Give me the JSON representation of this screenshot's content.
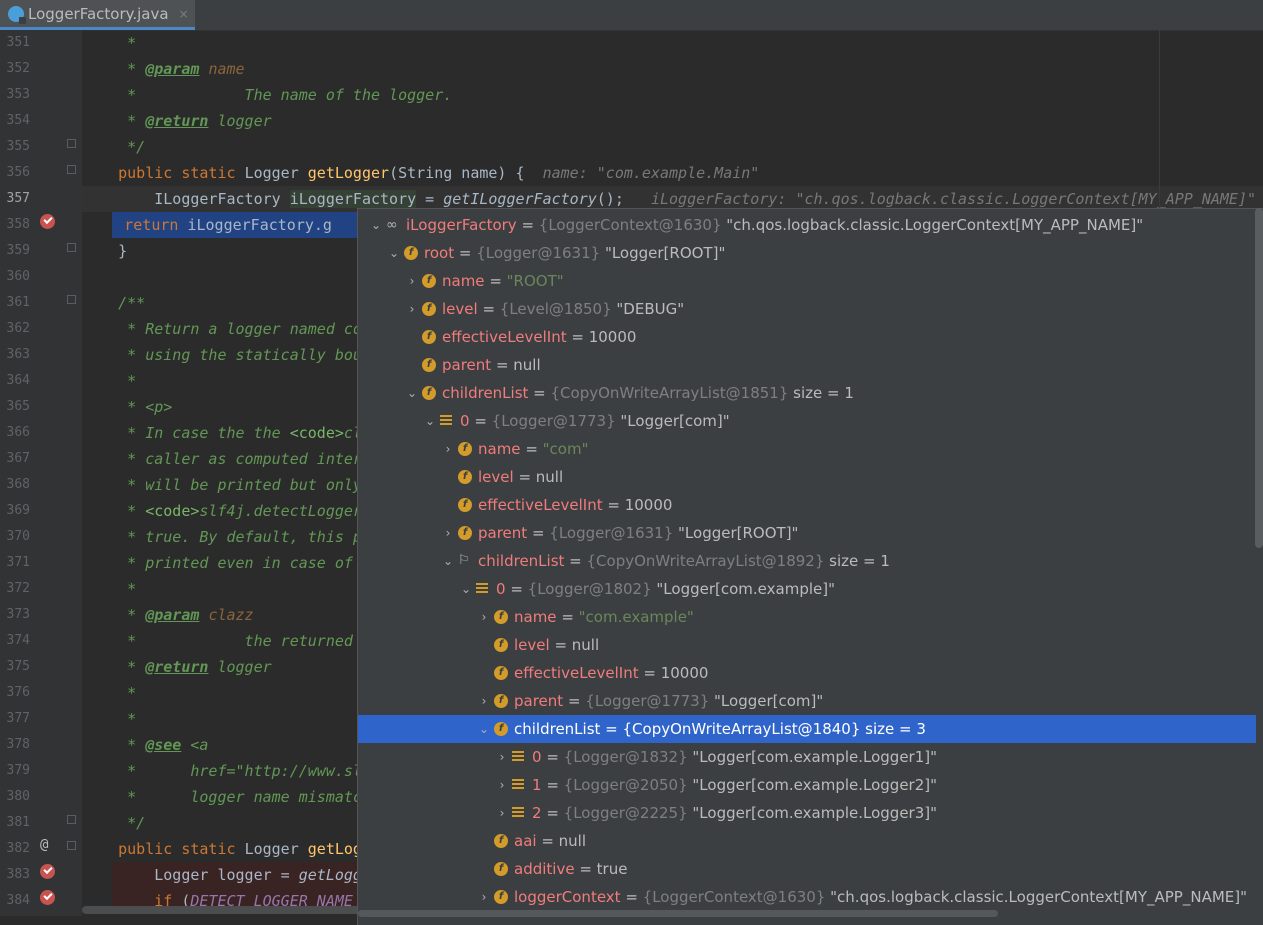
{
  "tab": {
    "title": "LoggerFactory.java",
    "close": "×"
  },
  "gutter": {
    "lines": [
      "351",
      "352",
      "353",
      "354",
      "355",
      "356",
      "357",
      "358",
      "359",
      "360",
      "361",
      "362",
      "363",
      "364",
      "365",
      "366",
      "367",
      "368",
      "369",
      "370",
      "371",
      "372",
      "373",
      "374",
      "375",
      "376",
      "377",
      "378",
      "379",
      "380",
      "381",
      "382",
      "383",
      "384"
    ]
  },
  "code": {
    "l351": "     *",
    "l352_a": "     * ",
    "l352_tag": "@param",
    "l352_b": " ",
    "l352_v": "name",
    "l353": "     *            The name of the logger.",
    "l354_a": "     * ",
    "l354_tag": "@return",
    "l354_b": " logger",
    "l355": "     */",
    "l356_kw": "    public static ",
    "l356_t": "Logger ",
    "l356_fn": "getLogger",
    "l356_r": "(String name) {  ",
    "l356_inl": "name: \"com.example.Main\"",
    "l357_a": "        ILoggerFactory ",
    "l357_v": "iLoggerFactory",
    "l357_b": " = ",
    "l357_c": "getILoggerFactory",
    "l357_d": "();",
    "l357_inl": "   iLoggerFactory: \"ch.qos.logback.classic.LoggerContext[MY_APP_NAME]\"",
    "l358_kw": "        return ",
    "l358_r": "iLoggerFactory.g",
    "l359": "    }",
    "l361": "    /**",
    "l362": "     * Return a logger named co",
    "l363": "     * using the statically bou",
    "l364": "     *",
    "l365": "     * <p>",
    "l366_a": "     * In case the the ",
    "l366_b": "<code>",
    "l366_c": "cl",
    "l367": "     * caller as computed inter",
    "l368": "     * will be printed but only",
    "l369_a": "     * ",
    "l369_b": "<code>",
    "l369_c": "slf4j.detectLogger",
    "l370": "     * true. By default, this p",
    "l371": "     * printed even in case of ",
    "l372": "     *",
    "l373_a": "     * ",
    "l373_tag": "@param",
    "l373_b": " ",
    "l373_v": "clazz",
    "l374": "     *            the returned ",
    "l375_a": "     * ",
    "l375_tag": "@return",
    "l375_b": " logger",
    "l376": "     *",
    "l377": "     *",
    "l378_a": "     * ",
    "l378_tag": "@see",
    "l378_b": " <a",
    "l379": "     *      href=\"http://www.sl",
    "l380": "     *      logger name mismatc",
    "l381": "     */",
    "l382_kw": "    public static ",
    "l382_t": "Logger ",
    "l382_fn": "getLogg",
    "l383_a": "        Logger logger = ",
    "l383_b": "getLogg",
    "l384_kw": "        if ",
    "l384_a": "(",
    "l384_st": "DETECT_LOGGER_NAME_"
  },
  "debugger": {
    "rows": [
      {
        "arrow": "⌄",
        "icon": "oo",
        "name": "iLoggerFactory",
        "eq": " = ",
        "ref": "{LoggerContext@1630}",
        "val": " \"ch.qos.logback.classic.LoggerContext[MY_APP_NAME]\""
      },
      {
        "arrow": "⌄",
        "icon": "f",
        "name": "root",
        "eq": " = ",
        "ref": "{Logger@1631}",
        "val": " \"Logger[ROOT]\""
      },
      {
        "arrow": "›",
        "icon": "f",
        "name": "name",
        "eq": " = ",
        "sval": "\"ROOT\""
      },
      {
        "arrow": "›",
        "icon": "f",
        "name": "level",
        "eq": " = ",
        "ref": "{Level@1850}",
        "val": " \"DEBUG\""
      },
      {
        "arrow": "",
        "icon": "f",
        "name": "effectiveLevelInt",
        "eq": " = ",
        "val": "10000"
      },
      {
        "arrow": "",
        "icon": "f",
        "name": "parent",
        "eq": " = ",
        "val": "null"
      },
      {
        "arrow": "⌄",
        "icon": "f",
        "name": "childrenList",
        "eq": " = ",
        "ref": "{CopyOnWriteArrayList@1851}",
        "val": "  size = 1"
      },
      {
        "arrow": "⌄",
        "icon": "list",
        "name": "0",
        "eq": " = ",
        "ref": "{Logger@1773}",
        "val": " \"Logger[com]\""
      },
      {
        "arrow": "›",
        "icon": "f",
        "name": "name",
        "eq": " = ",
        "sval": "\"com\""
      },
      {
        "arrow": "",
        "icon": "f",
        "name": "level",
        "eq": " = ",
        "val": "null"
      },
      {
        "arrow": "",
        "icon": "f",
        "name": "effectiveLevelInt",
        "eq": " = ",
        "val": "10000"
      },
      {
        "arrow": "›",
        "icon": "f",
        "name": "parent",
        "eq": " = ",
        "ref": "{Logger@1631}",
        "val": " \"Logger[ROOT]\""
      },
      {
        "arrow": "⌄",
        "icon": "flag",
        "name": "childrenList",
        "eq": " = ",
        "ref": "{CopyOnWriteArrayList@1892}",
        "val": "  size = 1"
      },
      {
        "arrow": "⌄",
        "icon": "list",
        "name": "0",
        "eq": " = ",
        "ref": "{Logger@1802}",
        "val": " \"Logger[com.example]\""
      },
      {
        "arrow": "›",
        "icon": "f",
        "name": "name",
        "eq": " = ",
        "sval": "\"com.example\""
      },
      {
        "arrow": "",
        "icon": "f",
        "name": "level",
        "eq": " = ",
        "val": "null"
      },
      {
        "arrow": "",
        "icon": "f",
        "name": "effectiveLevelInt",
        "eq": " = ",
        "val": "10000"
      },
      {
        "arrow": "›",
        "icon": "f",
        "name": "parent",
        "eq": " = ",
        "ref": "{Logger@1773}",
        "val": " \"Logger[com]\""
      },
      {
        "arrow": "⌄",
        "icon": "f",
        "name": "childrenList",
        "eq": " = ",
        "ref": "{CopyOnWriteArrayList@1840}",
        "val": "  size = 3"
      },
      {
        "arrow": "›",
        "icon": "list",
        "name": "0",
        "eq": " = ",
        "ref": "{Logger@1832}",
        "val": " \"Logger[com.example.Logger1]\""
      },
      {
        "arrow": "›",
        "icon": "list",
        "name": "1",
        "eq": " = ",
        "ref": "{Logger@2050}",
        "val": " \"Logger[com.example.Logger2]\""
      },
      {
        "arrow": "›",
        "icon": "list",
        "name": "2",
        "eq": " = ",
        "ref": "{Logger@2225}",
        "val": " \"Logger[com.example.Logger3]\""
      },
      {
        "arrow": "",
        "icon": "f",
        "name": "aai",
        "eq": " = ",
        "val": "null"
      },
      {
        "arrow": "",
        "icon": "f",
        "name": "additive",
        "eq": " = ",
        "val": "true"
      },
      {
        "arrow": "›",
        "icon": "f",
        "name": "loggerContext",
        "eq": " = ",
        "ref": "{LoggerContext@1630}",
        "val": " \"ch.qos.logback.classic.LoggerContext[MY_APP_NAME]\""
      }
    ]
  },
  "colors": {
    "selection": "#2f65ca",
    "editor_bg": "#2b2b2b",
    "comment": "#629755",
    "keyword": "#cc7832",
    "breakpoint": "#c75450"
  }
}
